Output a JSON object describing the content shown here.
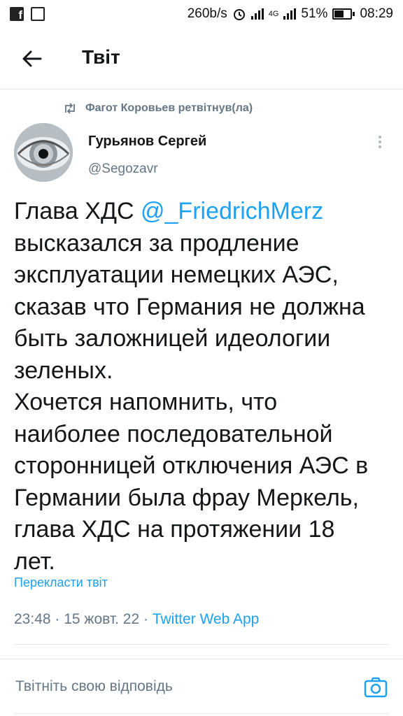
{
  "status_bar": {
    "net_speed": "260b/s",
    "network_type": "4G",
    "battery": "51%",
    "time": "08:29",
    "battery_level": 0.51
  },
  "header": {
    "title": "Твіт"
  },
  "tweet": {
    "retweeted_by": "Фагот Коровьев ретвітнув(ла)",
    "author_name": "Гурьянов Сергей",
    "author_handle": "@Segozavr",
    "text_before": "Глава ХДС ",
    "mention": "@_FriedrichMerz",
    "text_after": "\nвысказался за продление\nэксплуатации немецких АЭС,\nсказав что Германия не должна\nбыть заложницей идеологии\nзеленых.\nХочется напомнить, что\nнаиболее последовательной\nсторонницей отключения АЭС в\nГермании была фрау Меркель,\nглава ХДС на протяжении 18\nлет.",
    "translate_label": "Перекласти твіт",
    "time": "23:48",
    "date": "15 жовт. 22",
    "source_app": "Twitter Web App"
  },
  "reply_box": {
    "placeholder": "Твітніть свою відповідь"
  },
  "colors": {
    "accent": "#1da1f2",
    "secondary_text": "#657786",
    "divider": "#e1e8ed"
  },
  "icons": [
    "facebook-icon",
    "gallery-icon",
    "alarm-icon",
    "signal-icon",
    "battery-icon",
    "back-arrow-icon",
    "retweet-icon",
    "more-vertical-icon",
    "camera-icon"
  ]
}
